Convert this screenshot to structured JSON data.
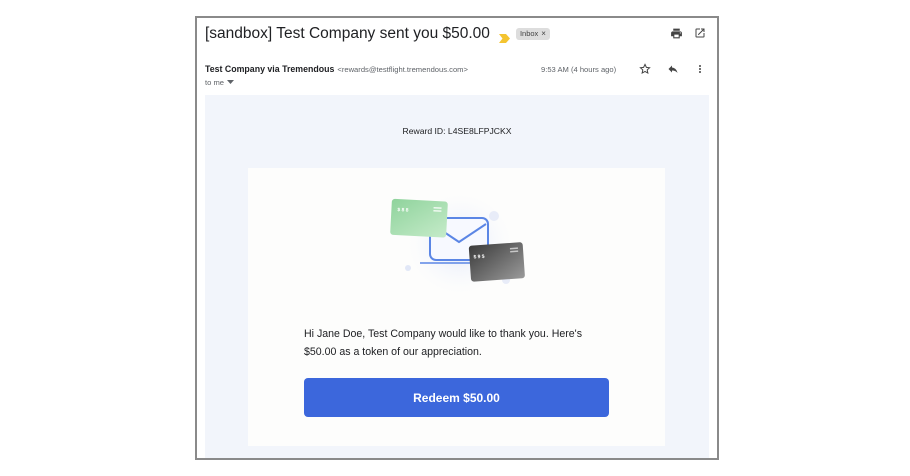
{
  "email": {
    "subject": "[sandbox] Test Company sent you $50.00",
    "label": "Inbox",
    "label_close": "×",
    "sender_name": "Test Company via Tremendous",
    "sender_email": "<rewards@testflight.tremendous.com>",
    "time": "9:53 AM (4 hours ago)",
    "recipient": "to me"
  },
  "icons": {
    "print": "print-icon",
    "open_new_window": "open-in-new-icon",
    "star": "star-icon",
    "reply": "reply-icon",
    "more": "more-vert-icon",
    "importance": "importance-marker-icon"
  },
  "content": {
    "reward_id": "Reward ID: L4SE8LFPJCKX",
    "message": "Hi Jane Doe, Test Company would like to thank you. Here's $50.00 as a token of our appreciation.",
    "button_label": "Redeem $50.00",
    "card_green_label": "$ 8 8",
    "card_dark_label": "$ 9 $"
  },
  "colors": {
    "button": "#3c67dc",
    "body_background": "#f2f5fb",
    "importance_marker": "#f4c430",
    "card_green": "#a8dcb0",
    "card_dark": "#2e2e2e"
  }
}
